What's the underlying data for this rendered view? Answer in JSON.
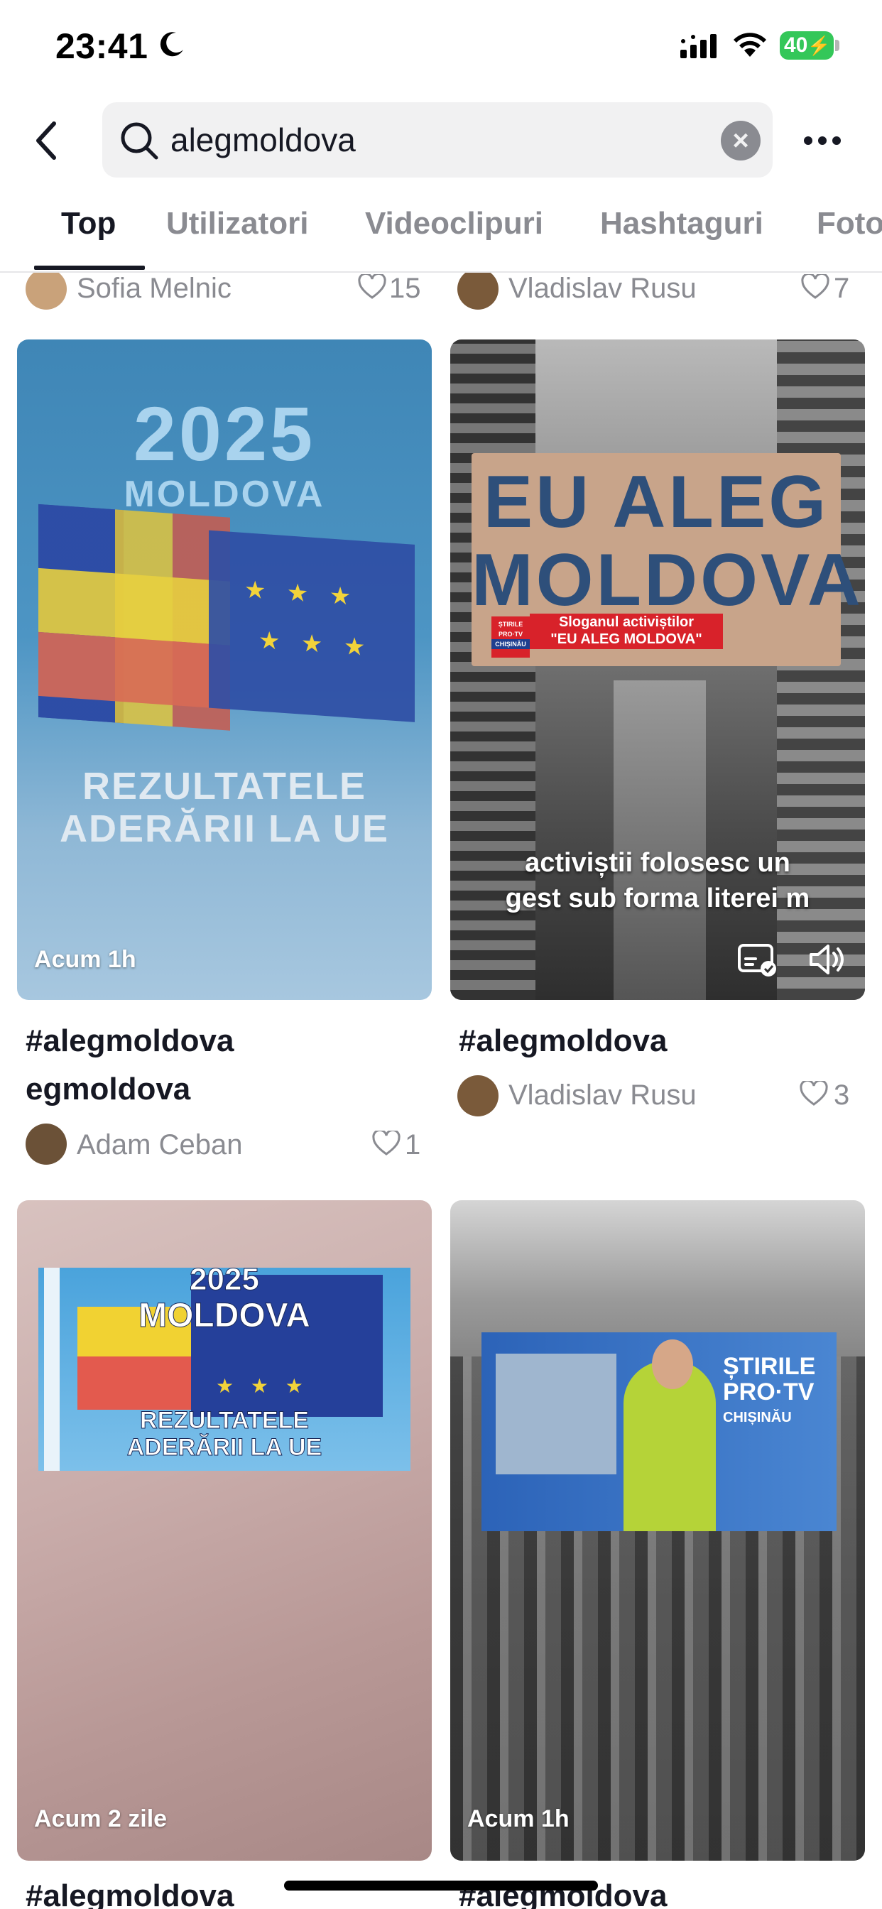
{
  "status_bar": {
    "time": "23:41",
    "battery": "40"
  },
  "search": {
    "query": "alegmoldova"
  },
  "tabs": [
    "Top",
    "Utilizatori",
    "Videoclipuri",
    "Hashtaguri",
    "Foto"
  ],
  "top_partial_row": [
    {
      "user": "Sofia Melnic",
      "likes": "15"
    },
    {
      "user": "Vladislav Rusu",
      "likes": "7"
    }
  ],
  "cards": [
    {
      "badge": "Acum 1h",
      "overlay_lines": [
        "2025",
        "MOLDOVA",
        "REZULTATELE",
        "ADERĂRII LA UE"
      ],
      "caption_lines": [
        "#alegmoldova",
        "egmoldova"
      ],
      "user": "Adam Ceban",
      "likes": "1"
    },
    {
      "badge": "",
      "overlay_lines": [
        "EU ALEG",
        "MOLDOVA"
      ],
      "news_strap": [
        "Sloganul activiștilor",
        "\"EU ALEG MOLDOVA\""
      ],
      "news_logo": [
        "ȘTIRILE",
        "PRO·TV",
        "CHIȘINĂU"
      ],
      "subtitle_lines": [
        "activiștii folosesc un",
        "gest sub forma literei m"
      ],
      "caption_lines": [
        "#alegmoldova"
      ],
      "user": "Vladislav Rusu",
      "likes": "3"
    },
    {
      "badge": "Acum 2 zile",
      "overlay_lines": [
        "2025",
        "MOLDOVA",
        "REZULTATELE",
        "ADERĂRII LA UE"
      ],
      "caption_lines": [
        "#alegmoldova"
      ]
    },
    {
      "badge": "Acum 1h",
      "overlay_lines": [
        "ȘTIRILE",
        "PRO·TV",
        "CHIȘINĂU"
      ],
      "caption_lines": [
        "#alegmoldova"
      ]
    }
  ]
}
